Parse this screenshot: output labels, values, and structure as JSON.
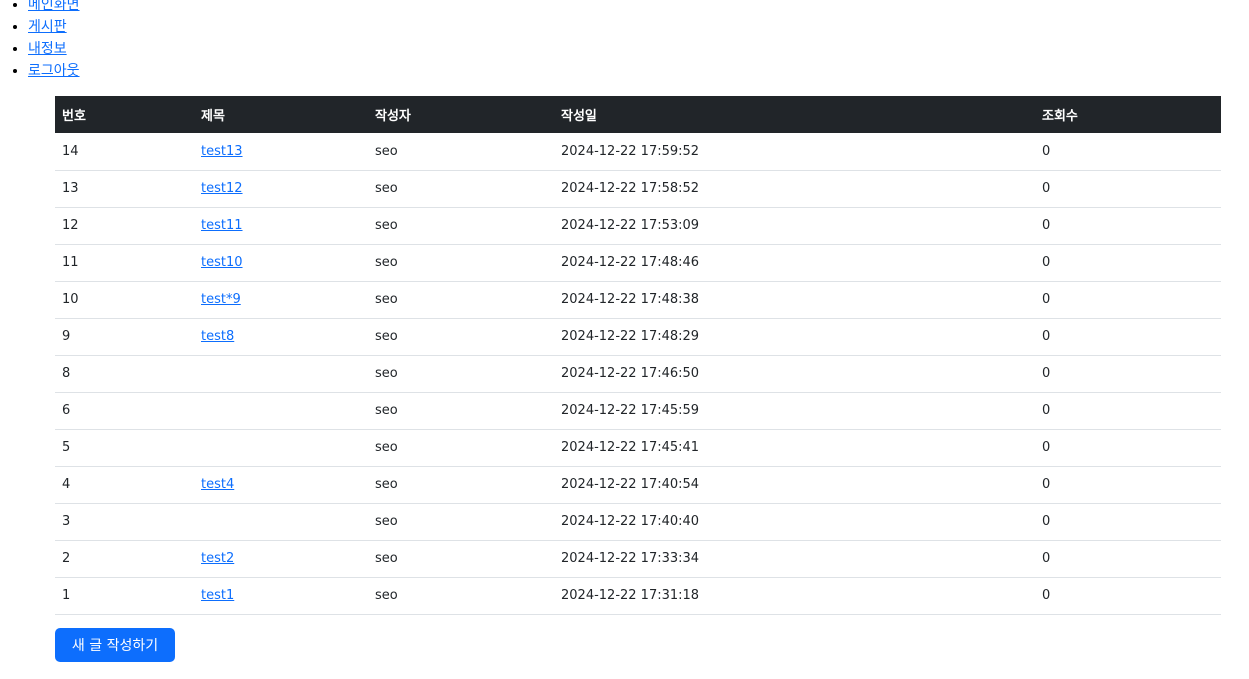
{
  "nav": {
    "items": [
      {
        "label": "메인화면"
      },
      {
        "label": "게시판"
      },
      {
        "label": "내정보"
      },
      {
        "label": "로그아웃"
      }
    ]
  },
  "table": {
    "headers": [
      "번호",
      "제목",
      "작성자",
      "작성일",
      "조회수"
    ],
    "rows": [
      {
        "no": "14",
        "title": "test13",
        "author": "seo",
        "date": "2024-12-22 17:59:52",
        "views": "0"
      },
      {
        "no": "13",
        "title": "test12",
        "author": "seo",
        "date": "2024-12-22 17:58:52",
        "views": "0"
      },
      {
        "no": "12",
        "title": "test11",
        "author": "seo",
        "date": "2024-12-22 17:53:09",
        "views": "0"
      },
      {
        "no": "11",
        "title": "test10",
        "author": "seo",
        "date": "2024-12-22 17:48:46",
        "views": "0"
      },
      {
        "no": "10",
        "title": "test*9",
        "author": "seo",
        "date": "2024-12-22 17:48:38",
        "views": "0"
      },
      {
        "no": "9",
        "title": "test8",
        "author": "seo",
        "date": "2024-12-22 17:48:29",
        "views": "0"
      },
      {
        "no": "8",
        "title": "",
        "author": "seo",
        "date": "2024-12-22 17:46:50",
        "views": "0"
      },
      {
        "no": "6",
        "title": "",
        "author": "seo",
        "date": "2024-12-22 17:45:59",
        "views": "0"
      },
      {
        "no": "5",
        "title": "",
        "author": "seo",
        "date": "2024-12-22 17:45:41",
        "views": "0"
      },
      {
        "no": "4",
        "title": "test4",
        "author": "seo",
        "date": "2024-12-22 17:40:54",
        "views": "0"
      },
      {
        "no": "3",
        "title": "",
        "author": "seo",
        "date": "2024-12-22 17:40:40",
        "views": "0"
      },
      {
        "no": "2",
        "title": "test2",
        "author": "seo",
        "date": "2024-12-22 17:33:34",
        "views": "0"
      },
      {
        "no": "1",
        "title": "test1",
        "author": "seo",
        "date": "2024-12-22 17:31:18",
        "views": "0"
      }
    ]
  },
  "actions": {
    "new_post_label": "새 글 작성하기"
  },
  "colors": {
    "link": "#0d6efd",
    "header_bg": "#212529",
    "button_bg": "#0d6efd"
  }
}
